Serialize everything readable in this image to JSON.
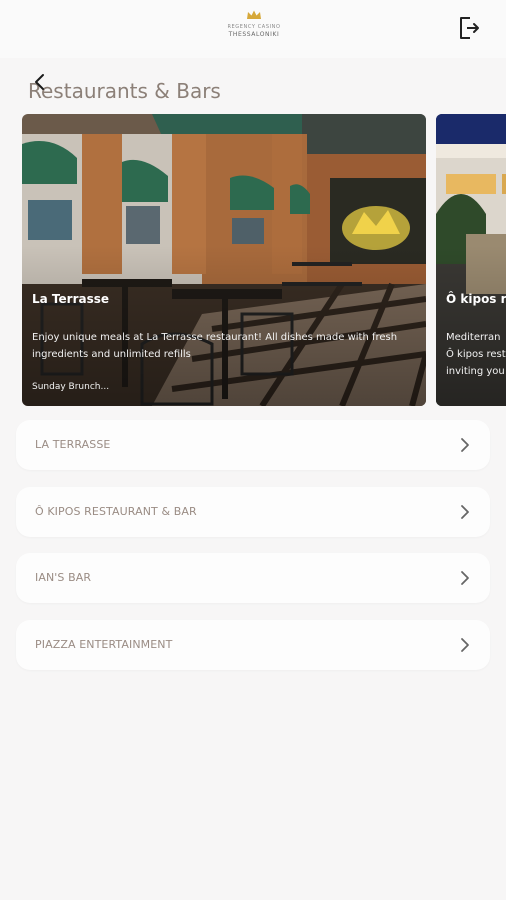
{
  "header": {
    "logo_line1": "REGENCY CASINO",
    "logo_line2": "THESSALONIKI",
    "logout_icon": "logout-icon"
  },
  "page": {
    "title": "Restaurants & Bars",
    "back_icon": "chevron-left-icon"
  },
  "carousel": {
    "cards": [
      {
        "title": "La Terrasse",
        "description": "Enjoy unique meals at La Terrasse restaurant! All dishes made with fresh ingredients and unlimited refills",
        "more": "Sunday Brunch..."
      },
      {
        "title": "Ô kipos re",
        "description": "Mediterran",
        "description2": "Ô kipos rest",
        "description3": "inviting you"
      }
    ]
  },
  "list": {
    "items": [
      {
        "label": "LA TERRASSE"
      },
      {
        "label": "Ô KIPOS RESTAURANT & BAR"
      },
      {
        "label": "IAN'S BAR"
      },
      {
        "label": "PIAZZA ENTERTAINMENT"
      }
    ],
    "chevron_icon": "chevron-right-icon"
  },
  "colors": {
    "background": "#f7f6f6",
    "title": "#8c8078",
    "list_text": "#9a8c84",
    "logo_gold": "#d6a83a"
  }
}
